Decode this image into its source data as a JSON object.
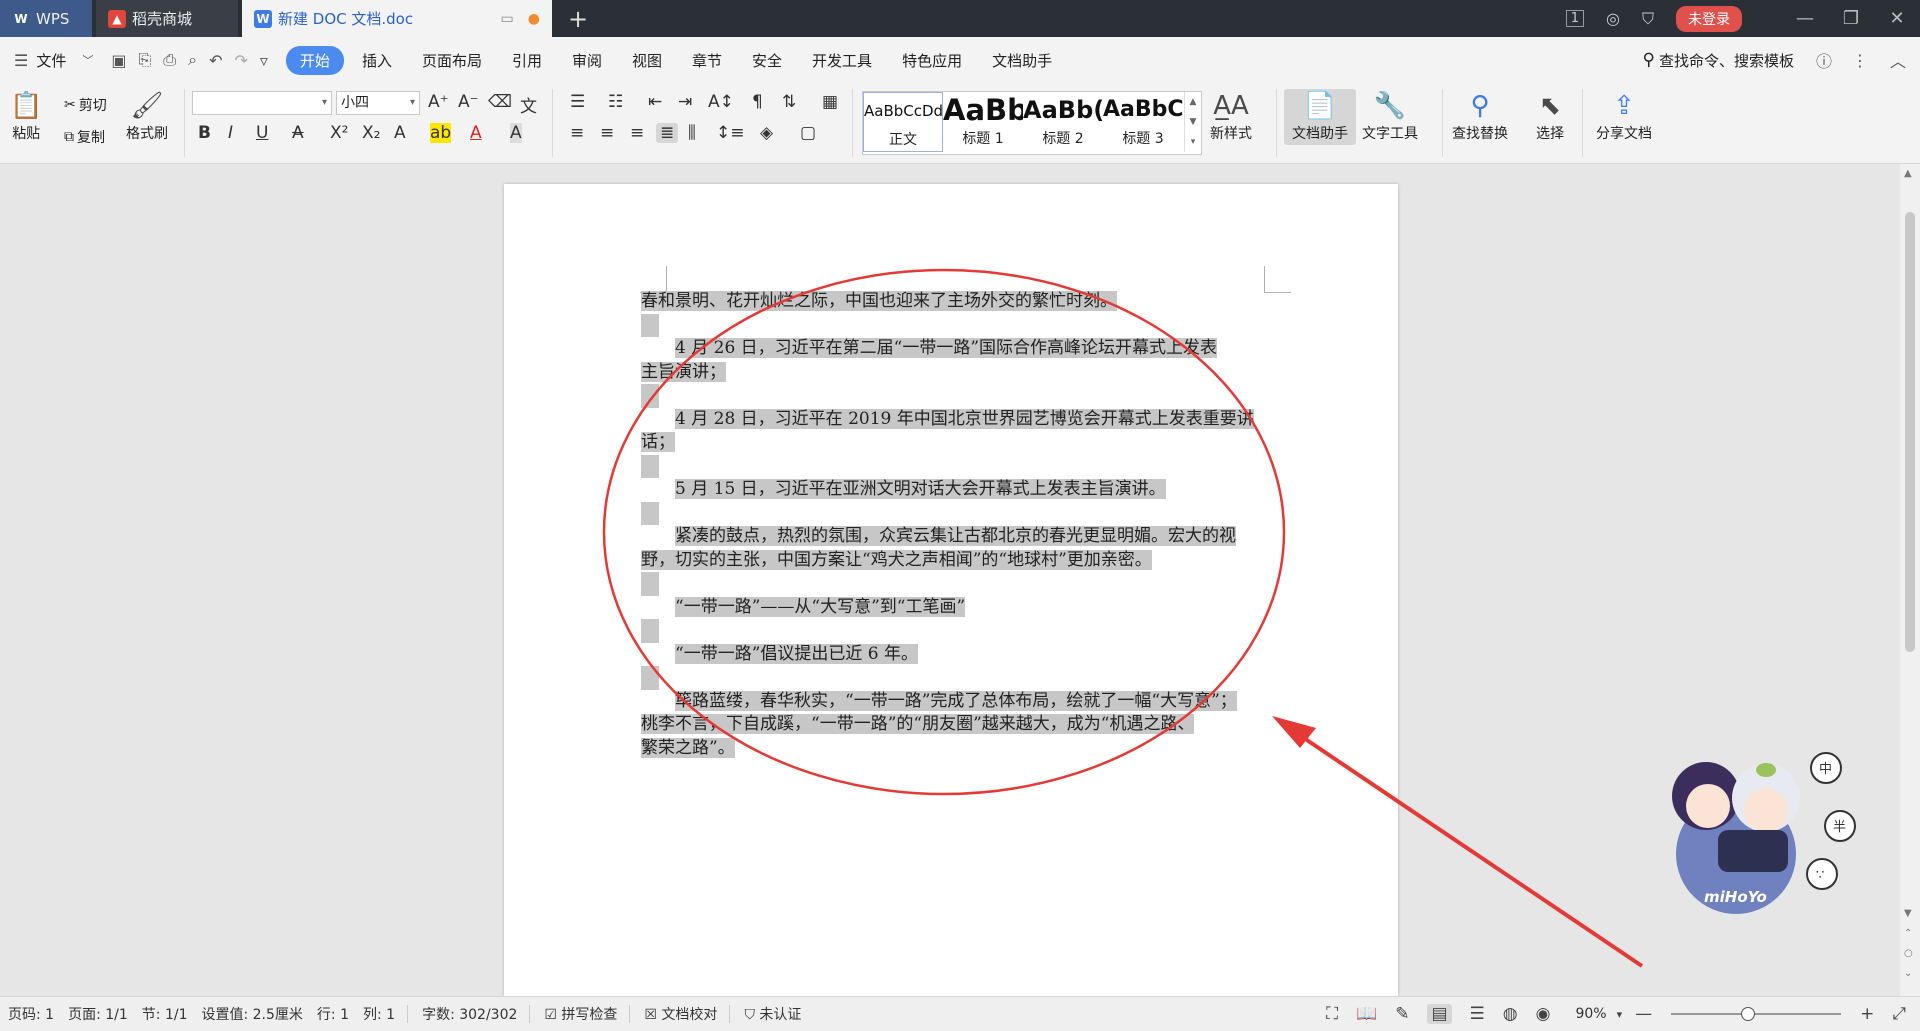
{
  "titlebar": {
    "tabs": [
      {
        "label": "WPS",
        "icon": "wps-logo-icon"
      },
      {
        "label": "稻壳商城",
        "icon": "flame-icon"
      },
      {
        "label": "新建 DOC 文档.doc",
        "icon": "word-doc-icon"
      }
    ],
    "page_badge": "1",
    "login_label": "未登录"
  },
  "menubar": {
    "file_label": "文件",
    "tabs": [
      "开始",
      "插入",
      "页面布局",
      "引用",
      "审阅",
      "视图",
      "章节",
      "安全",
      "开发工具",
      "特色应用",
      "文档助手"
    ],
    "active_tab": "开始",
    "search_label": "查找命令、搜索模板"
  },
  "ribbon": {
    "paste": "粘贴",
    "cut": "剪切",
    "copy": "复制",
    "format_painter": "格式刷",
    "font_name": "",
    "font_size": "小四",
    "styles": [
      {
        "preview": "AaBbCcDd",
        "name": "正文"
      },
      {
        "preview": "AaBb",
        "name": "标题 1"
      },
      {
        "preview": "AaBb(",
        "name": "标题 2"
      },
      {
        "preview": "AaBbC",
        "name": "标题 3"
      }
    ],
    "new_style": "新样式",
    "doc_assistant": "文档助手",
    "text_tools": "文字工具",
    "find_replace": "查找替换",
    "select": "选择",
    "share_doc": "分享文档"
  },
  "document": {
    "paragraphs": [
      {
        "lines": [
          "春和景明、花开灿烂之际，中国也迎来了主场外交的繁忙时刻。"
        ],
        "indent": false
      },
      {
        "lines": [
          "4 月 26 日，习近平在第二届“一带一路”国际合作高峰论坛开幕式上发表",
          "主旨演讲；"
        ],
        "indent": true
      },
      {
        "lines": [
          "4 月 28 日，习近平在 2019 年中国北京世界园艺博览会开幕式上发表重要讲",
          "话；"
        ],
        "indent": true
      },
      {
        "lines": [
          "5 月 15 日，习近平在亚洲文明对话大会开幕式上发表主旨演讲。"
        ],
        "indent": true
      },
      {
        "lines": [
          "紧凑的鼓点，热烈的氛围，众宾云集让古都北京的春光更显明媚。宏大的视",
          "野，切实的主张，中国方案让“鸡犬之声相闻”的“地球村”更加亲密。"
        ],
        "indent": true
      },
      {
        "lines": [
          "“一带一路”——从“大写意”到“工笔画”"
        ],
        "indent": true
      },
      {
        "lines": [
          "“一带一路”倡议提出已近 6 年。"
        ],
        "indent": true
      },
      {
        "lines": [
          "筚路蓝缕，春华秋实，“一带一路”完成了总体布局，绘就了一幅“大写意”；",
          "桃李不言，下自成蹊，“一带一路”的“朋友圈”越来越大，成为“机遇之路、",
          "繁荣之路”。"
        ],
        "indent": true
      }
    ]
  },
  "sticker": {
    "logo_text": "miHoYo"
  },
  "statusbar": {
    "page_num": "页码: 1",
    "pages": "页面: 1/1",
    "section": "节: 1/1",
    "setting": "设置值: 2.5厘米",
    "row": "行: 1",
    "col": "列: 1",
    "word_count": "字数: 302/302",
    "spell_check": "拼写检查",
    "proofread": "文档校对",
    "unverified": "未认证",
    "zoom": "90%"
  },
  "colors": {
    "accent": "#4b8bf0",
    "login": "#e0514b",
    "annotation": "#e53935"
  }
}
